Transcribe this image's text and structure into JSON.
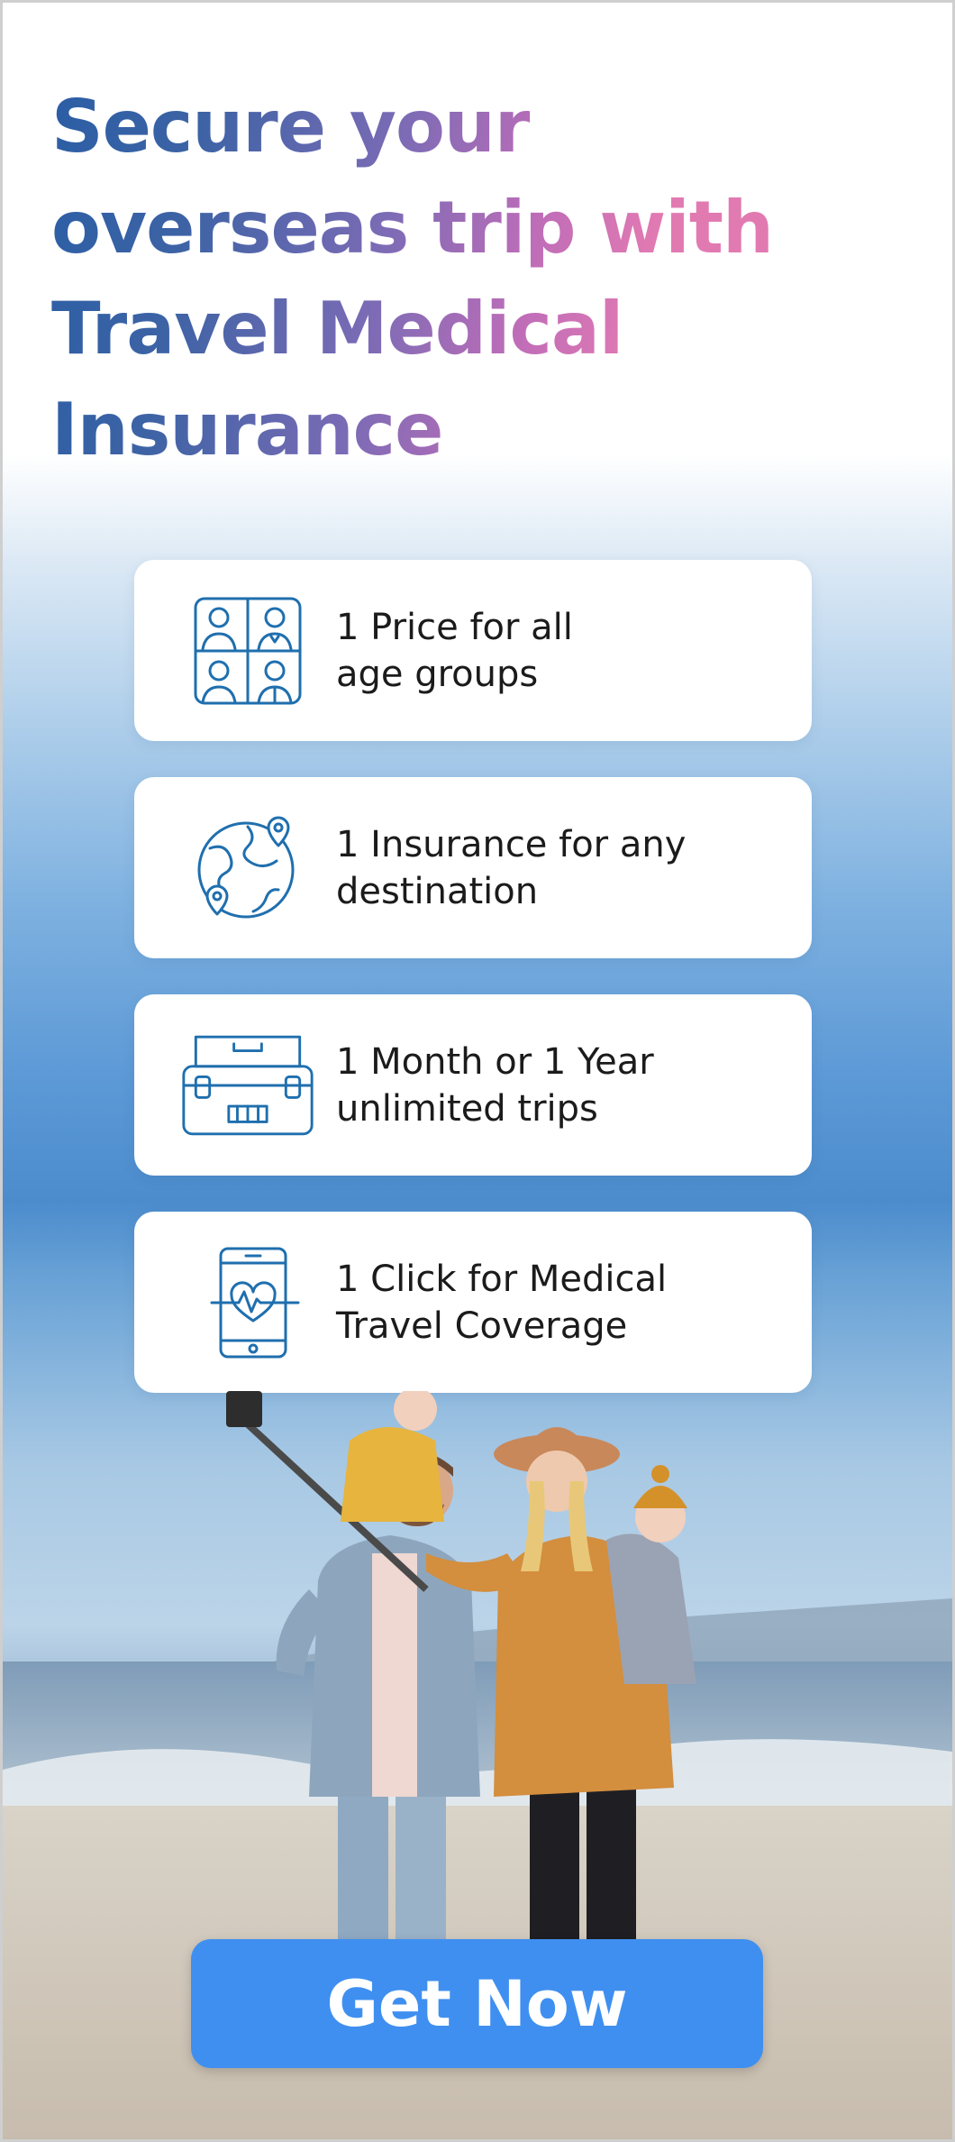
{
  "headline": {
    "line1": "Secure your",
    "line2": "overseas trip with",
    "line3": "Travel Medical",
    "line4": "Insurance"
  },
  "features": [
    {
      "icon": "four-people-grid-icon",
      "text": "1 Price for all\nage groups"
    },
    {
      "icon": "globe-location-pins-icon",
      "text": "1 Insurance for any\ndestination"
    },
    {
      "icon": "suitcase-icon",
      "text": "1 Month or 1 Year\nunlimited trips"
    },
    {
      "icon": "phone-heartbeat-icon",
      "text": "1 Click for Medical\nTravel Coverage"
    }
  ],
  "cta": {
    "label": "Get Now"
  },
  "colors": {
    "icon_blue": "#1f6fae",
    "cta_blue": "#3f8ff0",
    "headline_start": "#2b5ea5",
    "headline_end": "#e27ab2"
  }
}
